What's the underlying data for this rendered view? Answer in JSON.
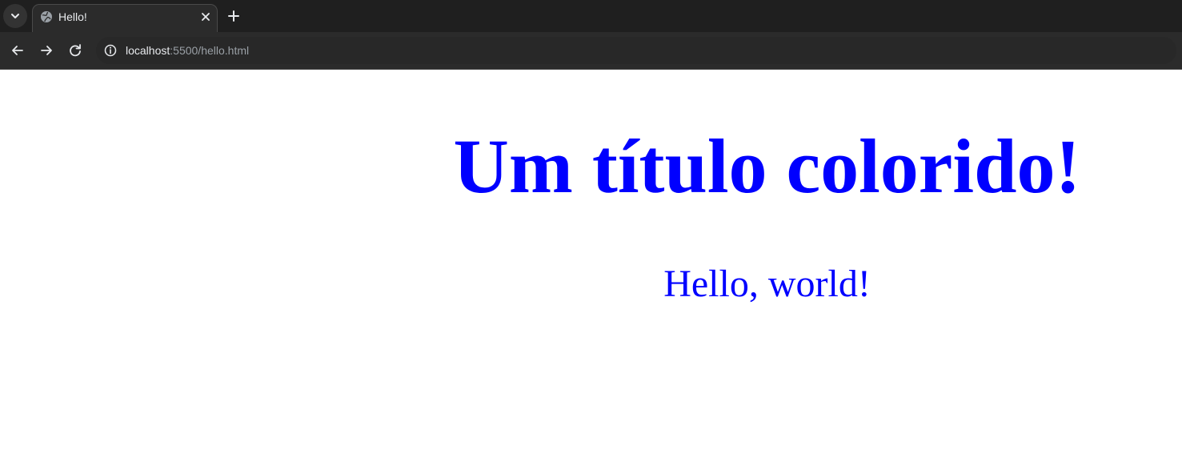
{
  "browser": {
    "tab": {
      "title": "Hello!",
      "favicon_icon": "globe-icon",
      "close_icon": "close-icon"
    },
    "tab_search_icon": "chevron-down-icon",
    "new_tab_icon": "plus-icon",
    "toolbar": {
      "back_icon": "arrow-left-icon",
      "forward_icon": "arrow-right-icon",
      "reload_icon": "reload-icon",
      "site_info_icon": "info-icon",
      "url_host": "localhost",
      "url_rest": ":5500/hello.html"
    }
  },
  "page": {
    "heading": "Um título colorido!",
    "paragraph": "Hello, world!"
  },
  "colors": {
    "text": "#0000ff",
    "chrome_dark": "#1f1f1f",
    "chrome_toolbar": "#2b2b2b"
  }
}
